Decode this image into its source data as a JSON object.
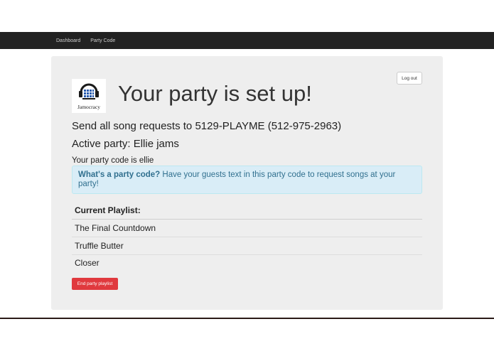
{
  "navbar": {
    "links": [
      "Dashboard",
      "Party Code"
    ]
  },
  "header": {
    "logout_label": "Log out",
    "logo_text": "Jamocracy",
    "title": "Your party is set up!"
  },
  "info": {
    "sms_line": "Send all song requests to 5129-PLAYME (512-975-2963)",
    "active_party": "Active party: Ellie jams",
    "party_code_line": "Your party code is ellie"
  },
  "alert": {
    "bold": "What's a party code?",
    "text": " Have your guests text in this party code to request songs at your party!"
  },
  "playlist": {
    "header": "Current Playlist:",
    "songs": [
      "The Final Countdown",
      "Truffle Butter",
      "Closer"
    ]
  },
  "actions": {
    "end_label": "End party playlist"
  },
  "colors": {
    "navbar": "#222222",
    "panel": "#eeeeee",
    "alert_bg": "#d9edf7",
    "alert_text": "#31708f",
    "danger": "#e0393e"
  }
}
